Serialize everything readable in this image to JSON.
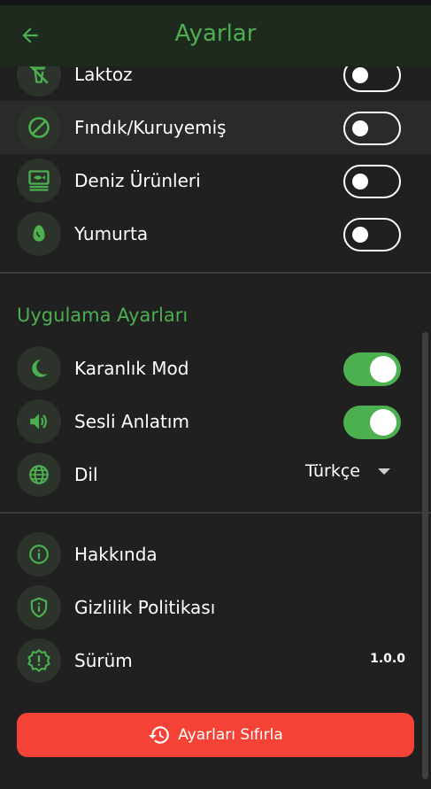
{
  "header": {
    "title": "Ayarlar",
    "back_icon": "arrow-back-icon"
  },
  "allergens": [
    {
      "label": "Laktoz",
      "icon": "no-drink-icon",
      "enabled": false
    },
    {
      "label": "Fındık/Kuruyemiş",
      "icon": "block-icon",
      "enabled": false
    },
    {
      "label": "Deniz Ürünleri",
      "icon": "set-meal-icon",
      "enabled": false
    },
    {
      "label": "Yumurta",
      "icon": "egg-icon",
      "enabled": false
    }
  ],
  "app_settings": {
    "title": "Uygulama Ayarları",
    "dark_mode": {
      "label": "Karanlık Mod",
      "icon": "moon-icon",
      "enabled": true
    },
    "voice": {
      "label": "Sesli Anlatım",
      "icon": "volume-icon",
      "enabled": true
    },
    "language": {
      "label": "Dil",
      "icon": "globe-icon",
      "value": "Türkçe"
    }
  },
  "info": {
    "about": {
      "label": "Hakkında",
      "icon": "info-icon"
    },
    "privacy": {
      "label": "Gizlilik Politikası",
      "icon": "shield-icon"
    },
    "version": {
      "label": "Sürüm",
      "icon": "version-badge-icon",
      "value": "1.0.0"
    }
  },
  "reset": {
    "label": "Ayarları Sıfırla",
    "icon": "restore-icon"
  },
  "colors": {
    "accent": "#4caf50",
    "danger": "#f44336",
    "background": "#202020"
  }
}
